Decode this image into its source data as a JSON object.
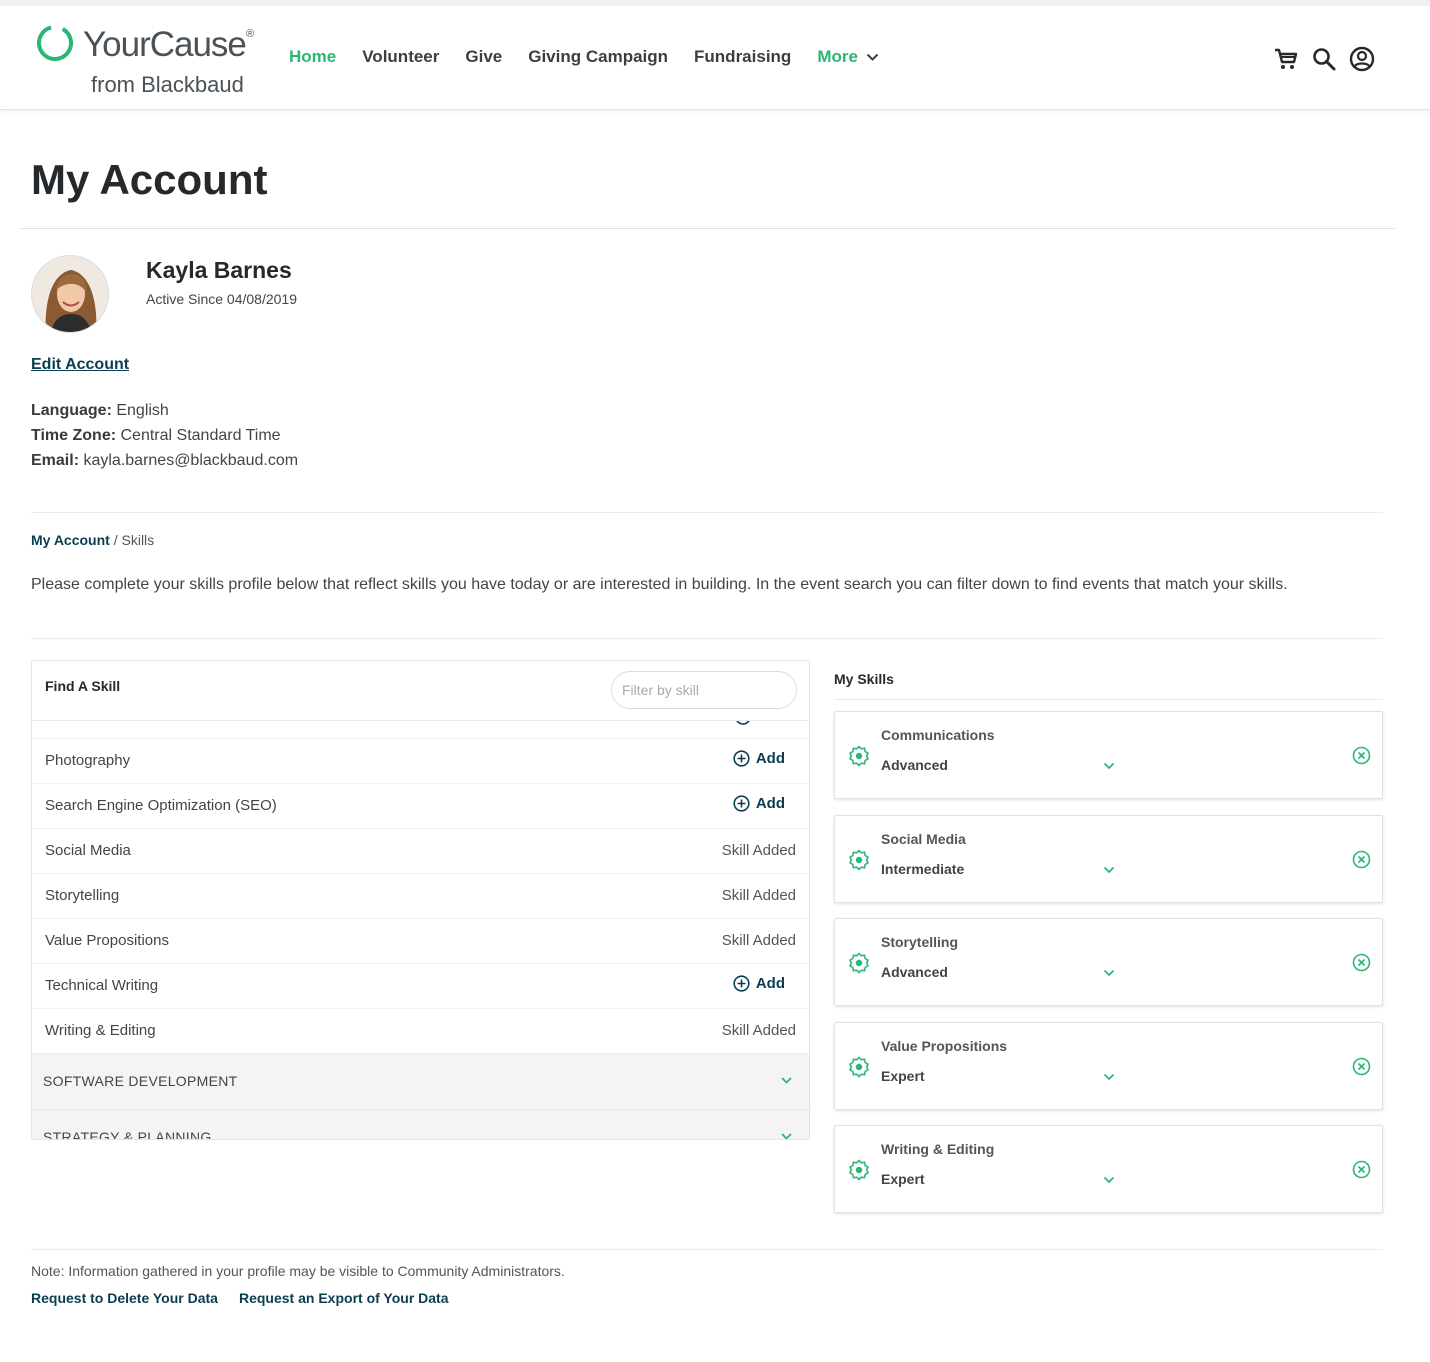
{
  "brand": {
    "name": "YourCause",
    "registered": "®",
    "sub": "from Blackbaud",
    "accent": "#2bb673",
    "dark": "#0b3d52"
  },
  "nav": {
    "items": [
      {
        "label": "Home",
        "active": true
      },
      {
        "label": "Volunteer"
      },
      {
        "label": "Give"
      },
      {
        "label": "Giving Campaign"
      },
      {
        "label": "Fundraising"
      },
      {
        "label": "More"
      }
    ],
    "icons": [
      "cart-icon",
      "search-icon",
      "account-icon"
    ]
  },
  "page": {
    "title": "My Account"
  },
  "profile": {
    "name": "Kayla Barnes",
    "active_since": "Active Since 04/08/2019",
    "edit_label": "Edit Account",
    "language_label": "Language:",
    "language": "English",
    "timezone_label": "Time Zone:",
    "timezone": "Central Standard Time",
    "email_label": "Email:",
    "email": "kayla.barnes@blackbaud.com"
  },
  "breadcrumb": {
    "root": "My Account",
    "sep": " / ",
    "current": "Skills"
  },
  "intro": "Please complete your skills profile below that reflect skills you have today or are interested in building. In the event search you can filter down to find events that match your skills.",
  "find": {
    "title": "Find A Skill",
    "filter_placeholder": "Filter by skill",
    "add_label": "Add",
    "added_label": "Skill Added",
    "skills": [
      {
        "name": "Photography",
        "status": "add"
      },
      {
        "name": "Search Engine Optimization (SEO)",
        "status": "add"
      },
      {
        "name": "Social Media",
        "status": "added"
      },
      {
        "name": "Storytelling",
        "status": "added"
      },
      {
        "name": "Value Propositions",
        "status": "added"
      },
      {
        "name": "Technical Writing",
        "status": "add"
      },
      {
        "name": "Writing & Editing",
        "status": "added"
      }
    ],
    "categories": [
      "SOFTWARE DEVELOPMENT",
      "STRATEGY & PLANNING"
    ]
  },
  "my_skills": {
    "title": "My Skills",
    "items": [
      {
        "name": "Communications",
        "level": "Advanced"
      },
      {
        "name": "Social Media",
        "level": "Intermediate"
      },
      {
        "name": "Storytelling",
        "level": "Advanced"
      },
      {
        "name": "Value Propositions",
        "level": "Expert"
      },
      {
        "name": "Writing & Editing",
        "level": "Expert"
      }
    ]
  },
  "footer": {
    "note": "Note: Information gathered in your profile may be visible to Community Administrators.",
    "delete_link": "Request to Delete Your Data",
    "export_link": "Request an Export of Your Data"
  }
}
